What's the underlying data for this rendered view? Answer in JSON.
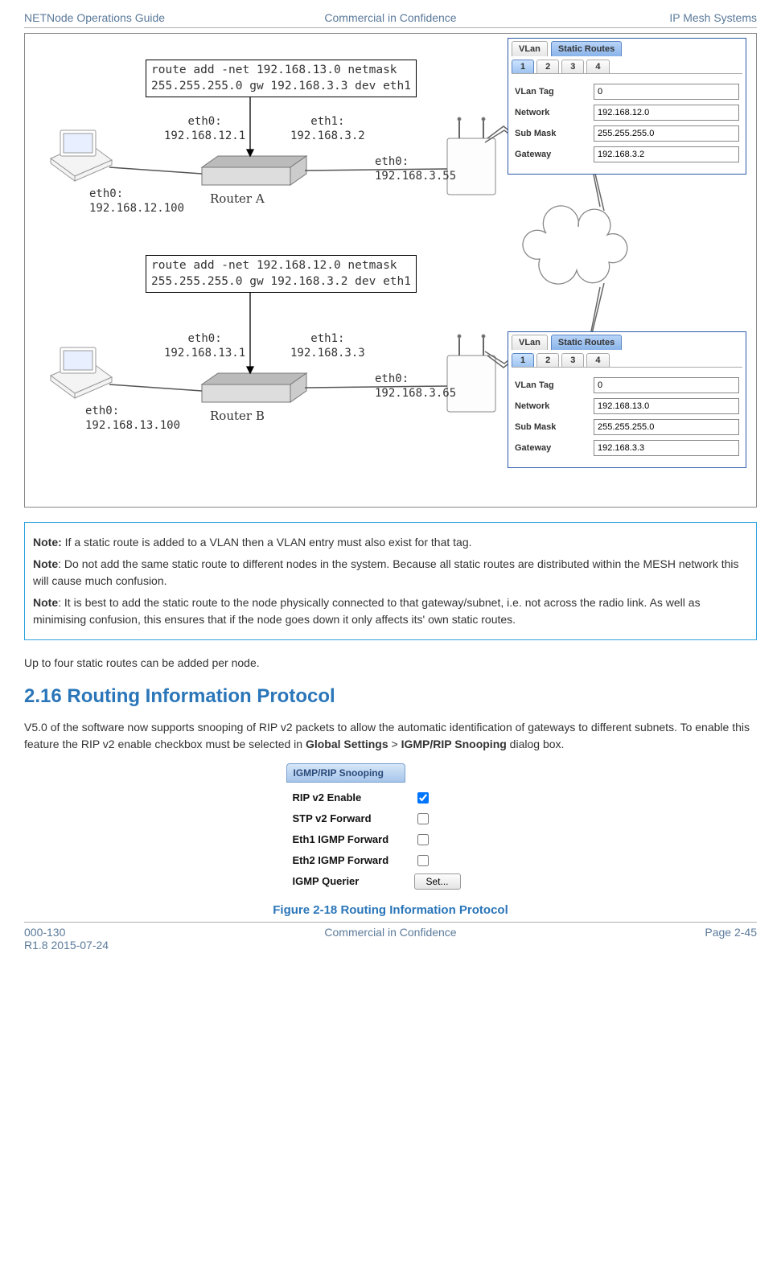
{
  "header": {
    "left": "NETNode Operations Guide",
    "center": "Commercial in Confidence",
    "right": "IP Mesh Systems"
  },
  "footer": {
    "left_top": "000-130",
    "left_bottom": "R1.8 2015-07-24",
    "center": "Commercial in Confidence",
    "right": "Page 2-45"
  },
  "diagram": {
    "route_a": "route add -net 192.168.13.0 netmask\n255.255.255.0 gw 192.168.3.3 dev eth1",
    "route_b": "route add -net 192.168.12.0 netmask\n255.255.255.0 gw 192.168.3.2 dev eth1",
    "router_a": {
      "name": "Router A",
      "eth0_label": "eth0:\n192.168.12.1",
      "eth1_label": "eth1:\n192.168.3.2"
    },
    "router_b": {
      "name": "Router B",
      "eth0_label": "eth0:\n192.168.13.1",
      "eth1_label": "eth1:\n192.168.3.3"
    },
    "laptop_a": "eth0:\n192.168.12.100",
    "laptop_b": "eth0:\n192.168.13.100",
    "node_a": "eth0:\n192.168.3.55",
    "node_b": "eth0:\n192.168.3.65",
    "panel_a": {
      "tabs": [
        "VLan",
        "Static Routes"
      ],
      "numtabs": [
        "1",
        "2",
        "3",
        "4"
      ],
      "vlan_tag_label": "VLan Tag",
      "vlan_tag": "0",
      "network_label": "Network",
      "network": "192.168.12.0",
      "submask_label": "Sub Mask",
      "submask": "255.255.255.0",
      "gateway_label": "Gateway",
      "gateway": "192.168.3.2"
    },
    "panel_b": {
      "tabs": [
        "VLan",
        "Static Routes"
      ],
      "numtabs": [
        "1",
        "2",
        "3",
        "4"
      ],
      "vlan_tag_label": "VLan Tag",
      "vlan_tag": "0",
      "network_label": "Network",
      "network": "192.168.13.0",
      "submask_label": "Sub Mask",
      "submask": "255.255.255.0",
      "gateway_label": "Gateway",
      "gateway": "192.168.3.3"
    }
  },
  "notes": {
    "n1_bold": "Note:",
    "n1": " If a static route is added to a VLAN then a VLAN entry must also exist for that tag.",
    "n2_bold": "Note",
    "n2": ": Do not add the same static route to different nodes in the system. Because all static routes are distributed within the MESH network this will cause much confusion.",
    "n3_bold": "Note",
    "n3": ": It is best to add the static route to the node physically connected to that gateway/subnet, i.e. not across the radio link. As well as minimising confusion, this ensures that if the node goes down it only affects its' own static routes."
  },
  "body": {
    "p1": "Up to four static routes can be added per node.",
    "h1": "2.16 Routing Information Protocol",
    "p2a": "V5.0 of the software now supports snooping of RIP v2 packets to allow the automatic identification of gateways to different subnets. To enable this feature the RIP v2 enable checkbox must be selected in ",
    "p2b": "Global Settings",
    "p2c": " > ",
    "p2d": "IGMP/RIP Snooping",
    "p2e": " dialog box."
  },
  "snoop": {
    "title": "IGMP/RIP Snooping",
    "rip_label": "RIP v2 Enable",
    "stp_label": "STP v2 Forward",
    "eth1_label": "Eth1 IGMP Forward",
    "eth2_label": "Eth2 IGMP Forward",
    "querier_label": "IGMP Querier",
    "set_btn": "Set..."
  },
  "caption": "Figure 2-18 Routing Information Protocol"
}
